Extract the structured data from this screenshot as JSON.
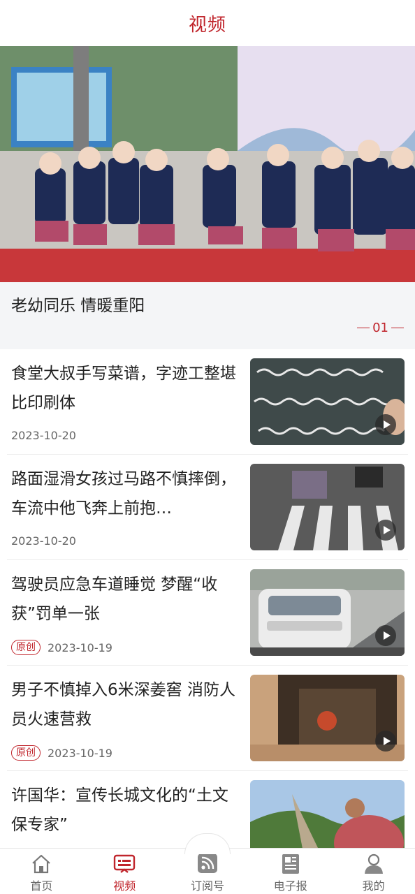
{
  "header": {
    "title": "视频"
  },
  "banner": {
    "caption": "老幼同乐 情暖重阳",
    "page_indicator": "01"
  },
  "news": [
    {
      "title": "食堂大叔手写菜谱，字迹工整堪比印刷体",
      "date": "2023-10-20",
      "badge": ""
    },
    {
      "title": "路面湿滑女孩过马路不慎摔倒，车流中他飞奔上前抱…",
      "date": "2023-10-20",
      "badge": ""
    },
    {
      "title": "驾驶员应急车道睡觉 梦醒“收获”罚单一张",
      "date": "2023-10-19",
      "badge": "原创"
    },
    {
      "title": "男子不慎掉入6米深姜窖 消防人员火速营救",
      "date": "2023-10-19",
      "badge": "原创"
    },
    {
      "title": "许国华：宣传长城文化的“土文保专家”",
      "date": "",
      "badge": ""
    }
  ],
  "tabbar": {
    "tabs": [
      {
        "label": "首页",
        "icon": "home-icon"
      },
      {
        "label": "视频",
        "icon": "video-icon"
      },
      {
        "label": "订阅号",
        "icon": "rss-icon"
      },
      {
        "label": "电子报",
        "icon": "newspaper-icon"
      },
      {
        "label": "我的",
        "icon": "user-icon"
      }
    ],
    "active_index": 1
  },
  "colors": {
    "accent": "#c0252c",
    "caption_bg": "#f4f5f7"
  }
}
